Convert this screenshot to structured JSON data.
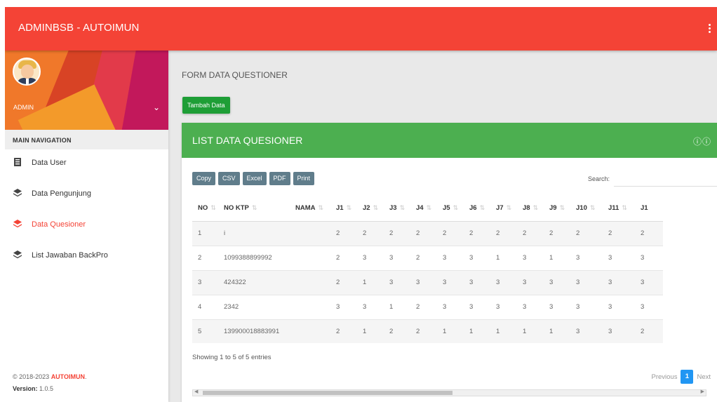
{
  "app": {
    "title": "ADMINBSB - AUTOIMUN"
  },
  "sidebar": {
    "user": {
      "name": "ADMIN"
    },
    "nav_header": "MAIN NAVIGATION",
    "items": [
      {
        "label": "Data User",
        "icon": "file-text-icon",
        "active": false
      },
      {
        "label": "Data Pengunjung",
        "icon": "layers-icon",
        "active": false
      },
      {
        "label": "Data Quesioner",
        "icon": "layers-icon",
        "active": true
      },
      {
        "label": "List Jawaban BackPro",
        "icon": "layers-icon",
        "active": false
      }
    ],
    "footer": {
      "copyright_prefix": "© 2018-2023 ",
      "brand": "AUTOIMUN",
      "brand_suffix": ".",
      "version_label": "Version:",
      "version_value": " 1.0.5"
    }
  },
  "main": {
    "page_title": "FORM DATA QUESTIONER",
    "add_button": "Tambah Data",
    "card": {
      "title": "LIST DATA QUESIONER",
      "export_buttons": [
        "Copy",
        "CSV",
        "Excel",
        "PDF",
        "Print"
      ],
      "search_label": "Search:",
      "search_value": "",
      "columns": [
        "NO",
        "NO KTP",
        "NAMA",
        "J1",
        "J2",
        "J3",
        "J4",
        "J5",
        "J6",
        "J7",
        "J8",
        "J9",
        "J10",
        "J11",
        "J1"
      ],
      "rows": [
        [
          "1",
          "i",
          "",
          "2",
          "2",
          "2",
          "2",
          "2",
          "2",
          "2",
          "2",
          "2",
          "2",
          "2",
          "2"
        ],
        [
          "2",
          "1099388899992",
          "",
          "2",
          "3",
          "3",
          "2",
          "3",
          "3",
          "1",
          "3",
          "1",
          "3",
          "3",
          "3"
        ],
        [
          "3",
          "424322",
          "",
          "2",
          "1",
          "3",
          "3",
          "3",
          "3",
          "3",
          "3",
          "3",
          "3",
          "3",
          "3"
        ],
        [
          "4",
          "2342",
          "",
          "3",
          "3",
          "1",
          "2",
          "3",
          "3",
          "3",
          "3",
          "3",
          "3",
          "3",
          "3"
        ],
        [
          "5",
          "139900018883991",
          "",
          "2",
          "1",
          "2",
          "2",
          "1",
          "1",
          "1",
          "1",
          "1",
          "3",
          "3",
          "2"
        ]
      ],
      "info": "Showing 1 to 5 of 5 entries",
      "pagination": {
        "previous": "Previous",
        "current": "1",
        "next": "Next"
      }
    }
  },
  "colors": {
    "header": "#f44336",
    "card_header": "#4caf50",
    "add_button": "#1e9e36",
    "export_button": "#607d8b",
    "page_active": "#2196f3",
    "nav_active": "#f44336"
  }
}
